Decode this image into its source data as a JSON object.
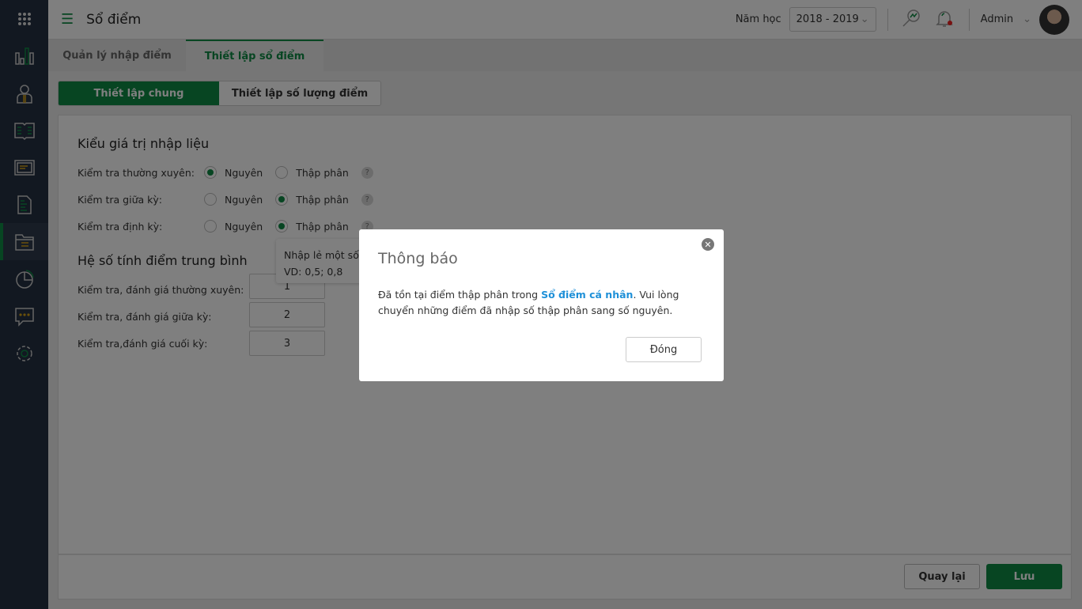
{
  "header": {
    "title": "Sổ điểm",
    "year_label": "Năm học",
    "year_value": "2018 - 2019",
    "user": "Admin"
  },
  "sidebar": {
    "items": [
      "apps",
      "dashboard",
      "teachers",
      "books",
      "board",
      "document",
      "grades",
      "reports",
      "messages",
      "settings"
    ],
    "active": "grades"
  },
  "tabs": [
    {
      "label": "Quản lý nhập điểm"
    },
    {
      "label": "Thiết lập sổ điểm"
    }
  ],
  "subtabs": [
    {
      "label": "Thiết lập chung"
    },
    {
      "label": "Thiết lập số lượng điểm"
    }
  ],
  "section1": {
    "title": "Kiểu giá trị nhập liệu",
    "opt_int": "Nguyên",
    "opt_dec": "Thập phân",
    "help": "?",
    "rows": [
      {
        "label": "Kiểm tra thường xuyên:",
        "selected": "Nguyên"
      },
      {
        "label": "Kiểm tra giữa kỳ:",
        "selected": "Thập phân"
      },
      {
        "label": "Kiểm tra định kỳ:",
        "selected": "Thập phân"
      }
    ]
  },
  "tooltip": {
    "line1": "Nhập lẻ một số",
    "line2": "VD: 0,5; 0,8"
  },
  "section2": {
    "title": "Hệ số tính điểm trung bình",
    "rows": [
      {
        "label": "Kiểm tra, đánh giá thường xuyên:",
        "value": "1"
      },
      {
        "label": "Kiểm tra, đánh giá giữa kỳ:",
        "value": "2"
      },
      {
        "label": "Kiểm tra,đánh giá cuối kỳ:",
        "value": "3"
      }
    ]
  },
  "footer": {
    "back": "Quay lại",
    "save": "Lưu"
  },
  "modal": {
    "title": "Thông báo",
    "text_before": "Đã tồn tại điểm thập phân trong ",
    "link": "Sổ điểm cá nhân",
    "text_after": ". Vui lòng chuyển những điểm đã nhập số thập phân sang số nguyên.",
    "close_button": "Đóng"
  },
  "colors": {
    "primary": "#0e8a44",
    "link": "#1e90d8",
    "sidebar": "#243042"
  }
}
